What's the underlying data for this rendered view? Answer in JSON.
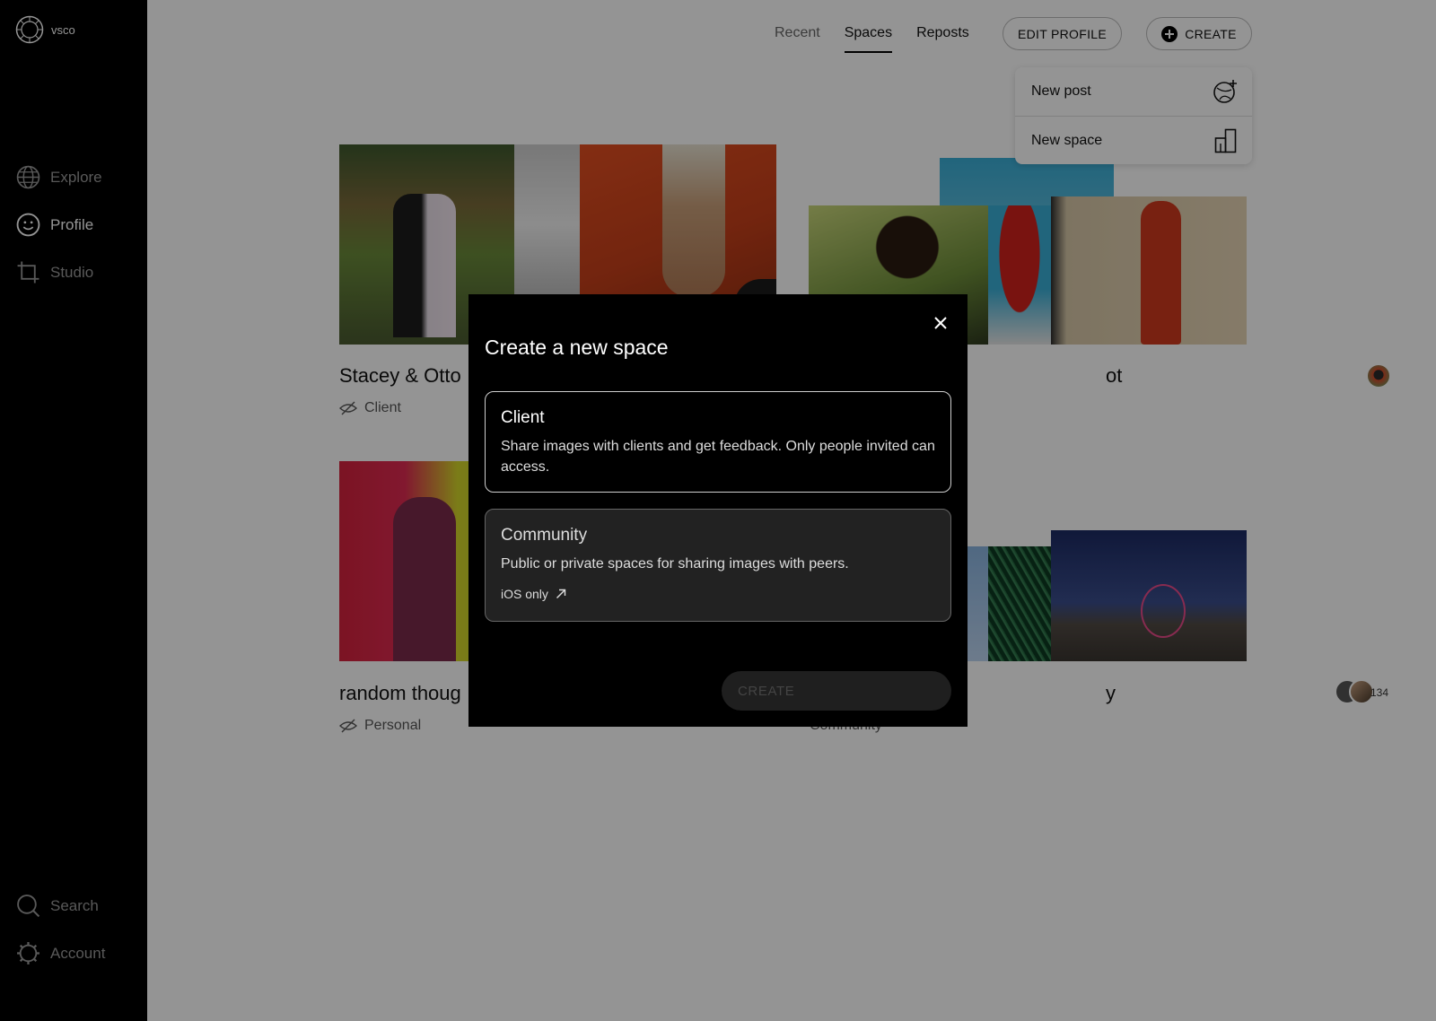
{
  "sidebar": {
    "brand": "vsco",
    "nav": [
      {
        "label": "Explore",
        "icon": "globe-icon"
      },
      {
        "label": "Profile",
        "icon": "smiley-icon"
      },
      {
        "label": "Studio",
        "icon": "crop-icon"
      }
    ],
    "bottom": [
      {
        "label": "Search",
        "icon": "search-icon"
      },
      {
        "label": "Account",
        "icon": "gear-icon"
      }
    ]
  },
  "header": {
    "tabs": [
      "Recent",
      "Spaces",
      "Reposts"
    ],
    "active_tab": "Spaces",
    "edit_profile": "EDIT PROFILE",
    "create": "CREATE"
  },
  "create_menu": {
    "items": [
      {
        "label": "New post",
        "icon": "new-post-icon"
      },
      {
        "label": "New space",
        "icon": "new-space-icon"
      }
    ]
  },
  "spaces": [
    {
      "title": "Stacey & Otto",
      "type": "Client"
    },
    {
      "title": "ot",
      "type": ""
    },
    {
      "title": "random thoug",
      "type": "Personal"
    },
    {
      "title": "y",
      "type": "Community",
      "member_count": "134"
    }
  ],
  "modal": {
    "title": "Create a new space",
    "options": [
      {
        "title": "Client",
        "description": "Share images with clients and get feedback. Only people invited can access."
      },
      {
        "title": "Community",
        "description": "Public or private spaces for sharing images with peers.",
        "link": "iOS only"
      }
    ],
    "create_button": "CREATE"
  }
}
